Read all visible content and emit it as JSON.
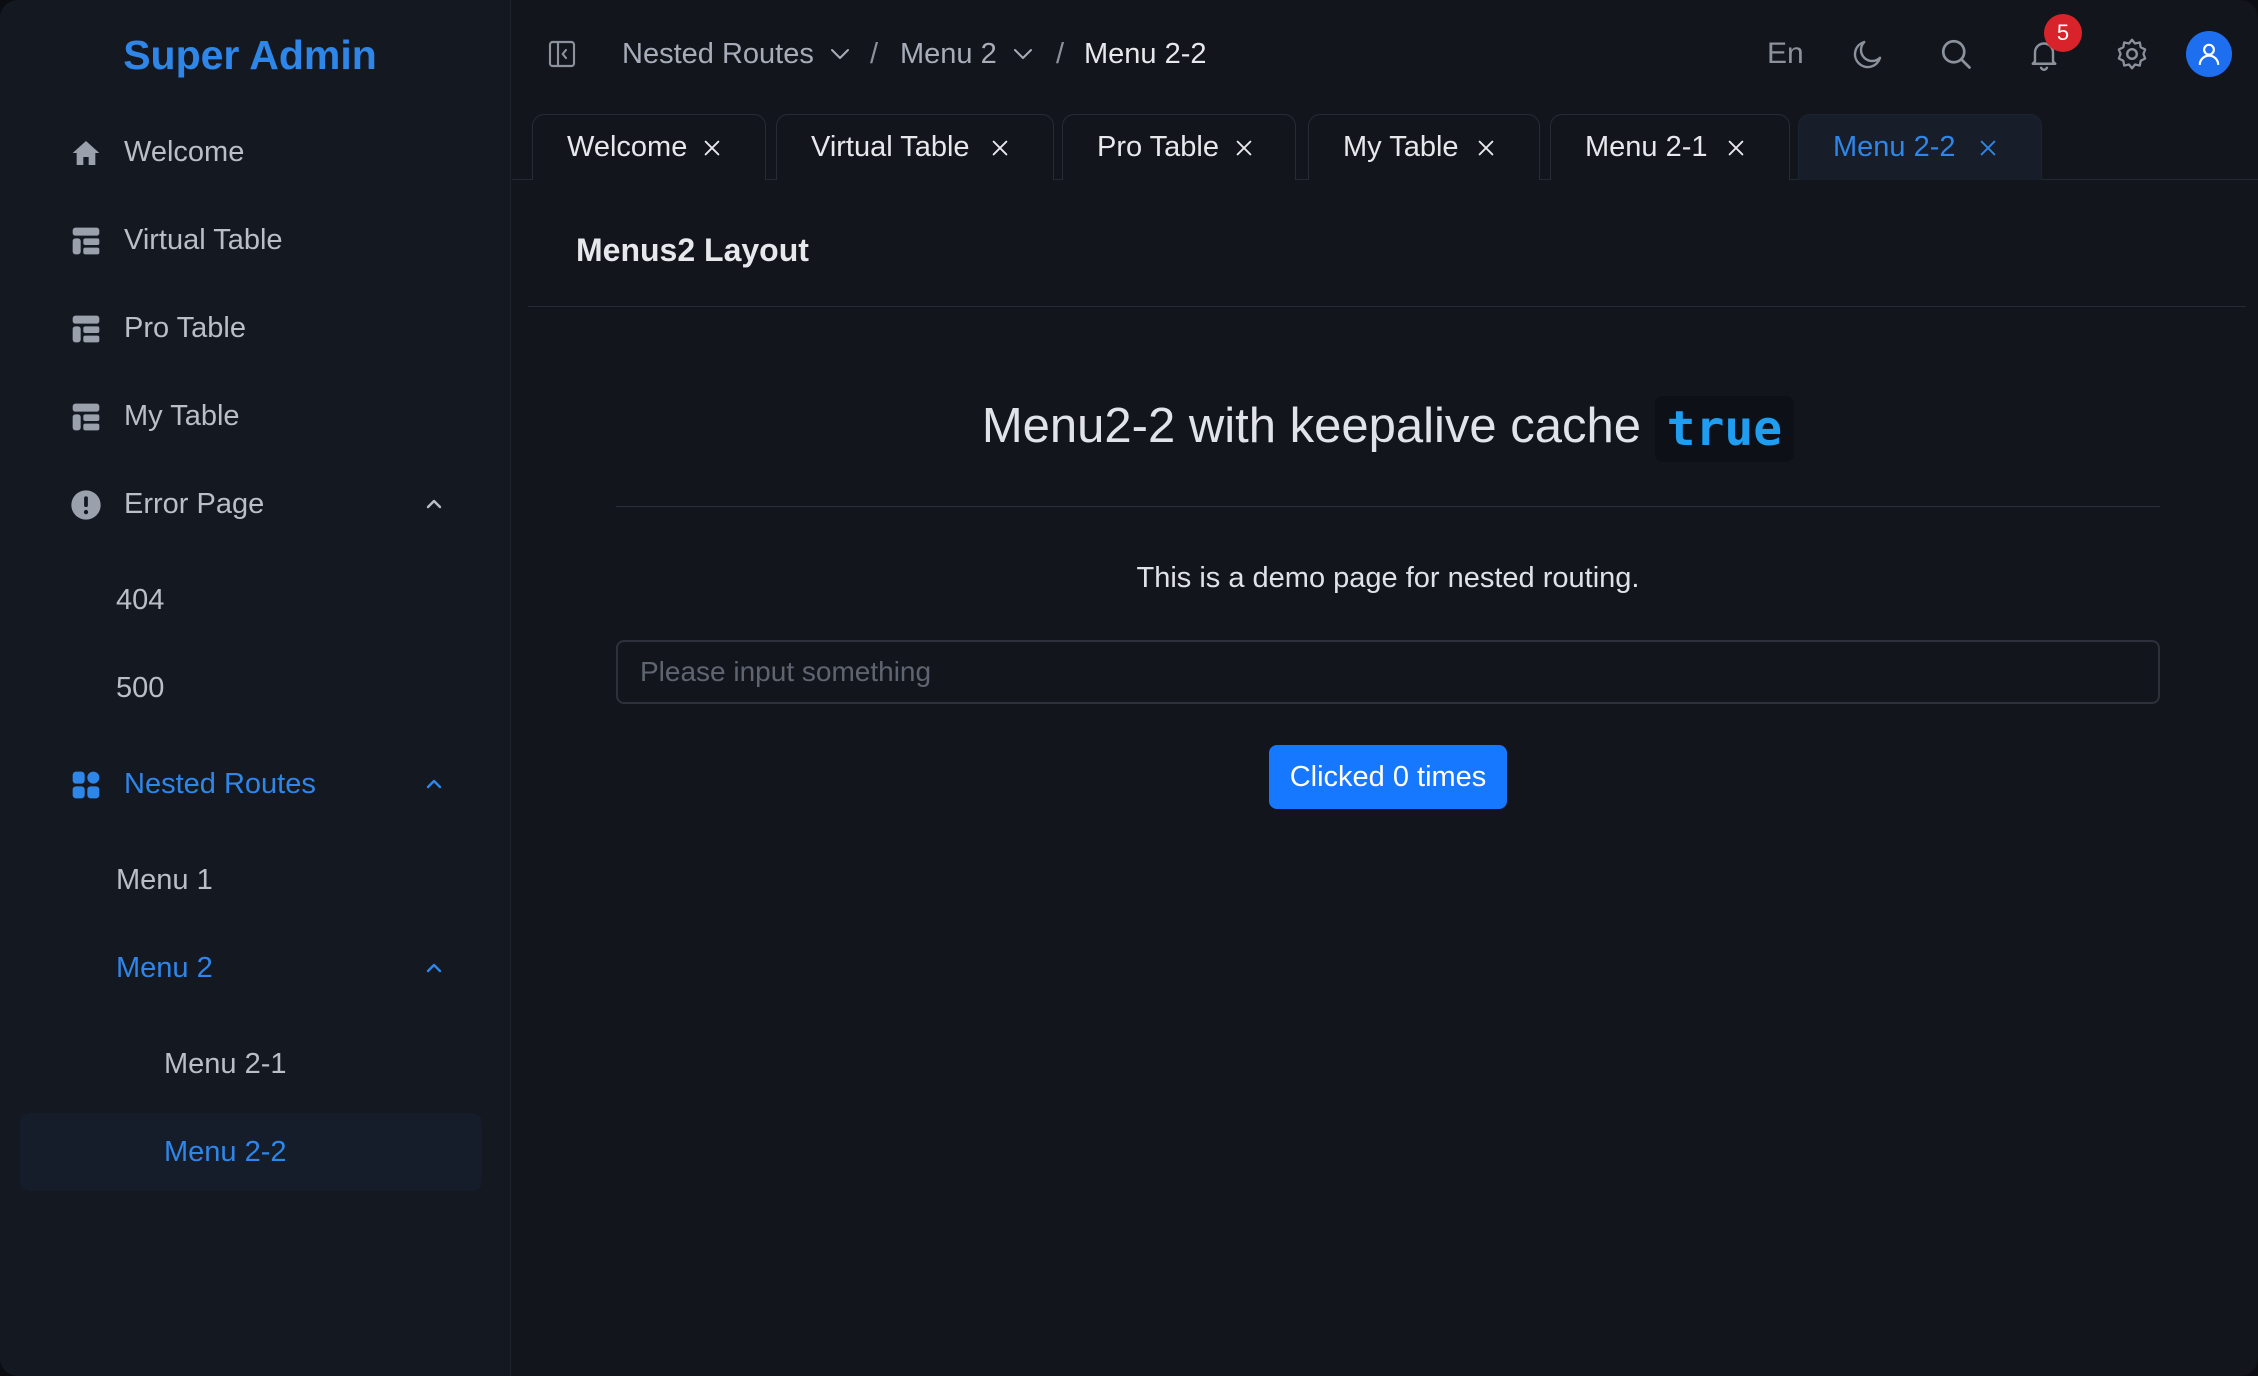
{
  "app": {
    "title": "Super Admin"
  },
  "sidebar": {
    "items": [
      {
        "label": "Welcome",
        "icon": "home-icon"
      },
      {
        "label": "Virtual Table",
        "icon": "table-icon"
      },
      {
        "label": "Pro Table",
        "icon": "table-icon"
      },
      {
        "label": "My Table",
        "icon": "table-icon"
      },
      {
        "label": "Error Page",
        "icon": "exclamation-circle-icon",
        "expanded": true,
        "children": [
          {
            "label": "404"
          },
          {
            "label": "500"
          }
        ]
      },
      {
        "label": "Nested Routes",
        "icon": "apps-icon",
        "expanded": true,
        "active": true,
        "children": [
          {
            "label": "Menu 1"
          },
          {
            "label": "Menu 2",
            "expanded": true,
            "active": true,
            "children": [
              {
                "label": "Menu 2-1"
              },
              {
                "label": "Menu 2-2",
                "selected": true
              }
            ]
          }
        ]
      }
    ]
  },
  "header": {
    "breadcrumb": [
      {
        "label": "Nested Routes",
        "dropdown": true
      },
      {
        "label": "Menu 2",
        "dropdown": true
      },
      {
        "label": "Menu 2-2",
        "dropdown": false
      }
    ],
    "separator": "/",
    "language": "En",
    "notifications_count": "5",
    "icons": [
      "sidebar-collapse-icon",
      "moon-icon",
      "search-icon",
      "bell-icon",
      "gear-icon",
      "user-icon"
    ]
  },
  "tabs": [
    {
      "label": "Welcome"
    },
    {
      "label": "Virtual Table"
    },
    {
      "label": "Pro Table"
    },
    {
      "label": "My Table"
    },
    {
      "label": "Menu 2-1"
    },
    {
      "label": "Menu 2-2",
      "active": true
    }
  ],
  "content": {
    "page_title": "Menus2 Layout",
    "heading_text": "Menu2-2 with keepalive cache",
    "heading_code": "true",
    "description": "This is a demo page for nested routing.",
    "input_placeholder": "Please input something",
    "input_value": "",
    "button_label": "Clicked 0 times"
  },
  "colors": {
    "accent": "#2f86e9",
    "primary_button": "#1677ff",
    "badge": "#d8232a",
    "background": "#12151c",
    "sidebar": "#141821"
  }
}
